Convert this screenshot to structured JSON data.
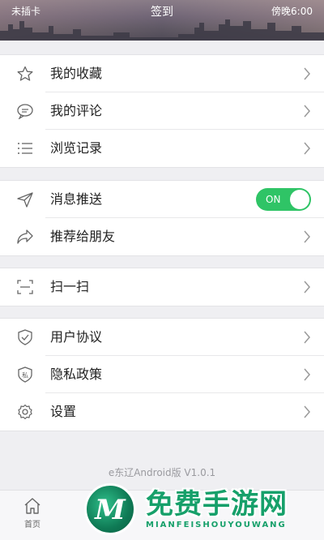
{
  "status_bar": {
    "carrier": "未插卡",
    "title": "签到",
    "time_text": "傍晚6:00"
  },
  "groups": [
    {
      "items": [
        {
          "label": "我的收藏",
          "icon": "star-icon"
        },
        {
          "label": "我的评论",
          "icon": "comment-icon"
        },
        {
          "label": "浏览记录",
          "icon": "list-icon"
        }
      ]
    },
    {
      "items": [
        {
          "label": "消息推送",
          "icon": "send-icon",
          "toggle": "ON"
        },
        {
          "label": "推荐给朋友",
          "icon": "share-icon"
        }
      ]
    },
    {
      "items": [
        {
          "label": "扫一扫",
          "icon": "scan-icon"
        }
      ]
    },
    {
      "items": [
        {
          "label": "用户协议",
          "icon": "shield-check-icon"
        },
        {
          "label": "隐私政策",
          "icon": "shield-private-icon",
          "icon_text": "私"
        },
        {
          "label": "设置",
          "icon": "gear-icon"
        }
      ]
    }
  ],
  "version": "e东辽Android版 V1.0.1",
  "tabbar": {
    "tabs": [
      {
        "label": "首页",
        "icon": "home-icon"
      }
    ]
  },
  "watermark": {
    "logo_letter": "M",
    "title": "免费手游网",
    "subtitle": "MIANFEISHOUYOUWANG"
  },
  "colors": {
    "toggle_on": "#2fc466",
    "watermark_green": "#16a06a"
  }
}
